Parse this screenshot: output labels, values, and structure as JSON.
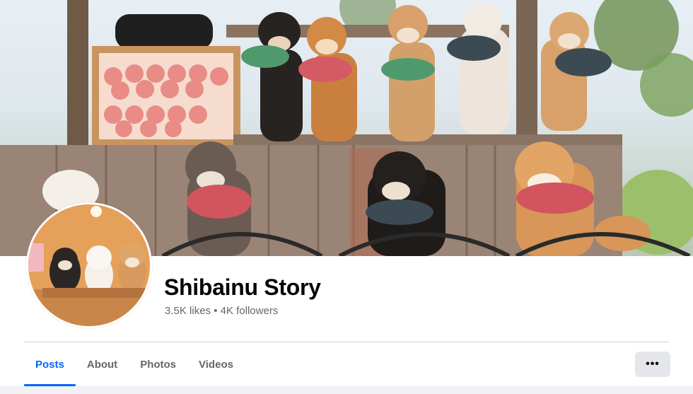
{
  "page": {
    "title": "Shibainu Story",
    "stats": "3.5K likes • 4K followers"
  },
  "cover_photo": {
    "alt": "cover-photo",
    "icon": "shiba-dogs-cover"
  },
  "profile_photo": {
    "icon": "shiba-dogs-avatar"
  },
  "tabs": [
    {
      "label": "Posts",
      "active": true
    },
    {
      "label": "About",
      "active": false
    },
    {
      "label": "Photos",
      "active": false
    },
    {
      "label": "Videos",
      "active": false
    }
  ],
  "more_button": {
    "label": "•••"
  },
  "colors": {
    "accent": "#0866ff",
    "title": "#050505",
    "secondary_text": "#65676b",
    "button_bg": "#e4e6eb"
  }
}
